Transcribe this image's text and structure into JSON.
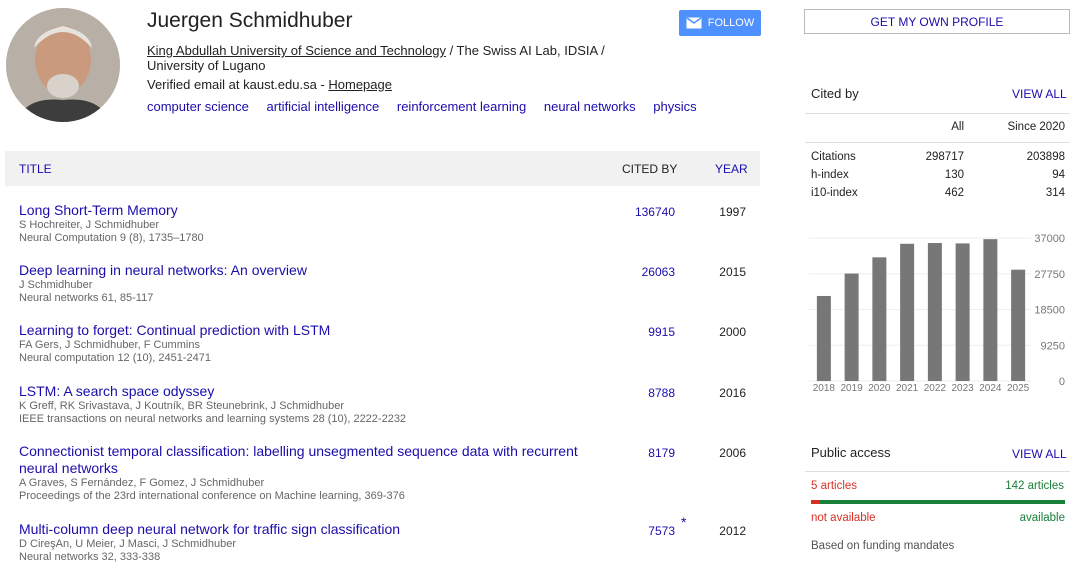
{
  "profile": {
    "name": "Juergen Schmidhuber",
    "affiliation_link": "King Abdullah University of Science and Technology",
    "affiliation_rest": " / The Swiss AI Lab, IDSIA / University of Lugano",
    "email_text": "Verified email at kaust.edu.sa - ",
    "homepage_link": "Homepage",
    "interests": [
      "computer science",
      "artificial intelligence",
      "reinforcement learning",
      "neural networks",
      "physics"
    ],
    "follow_label": "FOLLOW"
  },
  "table": {
    "col_title": "TITLE",
    "col_cited": "CITED BY",
    "col_year": "YEAR",
    "rows": [
      {
        "title": "Long Short-Term Memory",
        "authors": "S Hochreiter, J Schmidhuber",
        "venue": "Neural Computation 9 (8), 1735–1780",
        "cited": "136740",
        "year": "1997"
      },
      {
        "title": "Deep learning in neural networks: An overview",
        "authors": "J Schmidhuber",
        "venue": "Neural networks 61, 85-117",
        "cited": "26063",
        "year": "2015"
      },
      {
        "title": "Learning to forget: Continual prediction with LSTM",
        "authors": "FA Gers, J Schmidhuber, F Cummins",
        "venue": "Neural computation 12 (10), 2451-2471",
        "cited": "9915",
        "year": "2000"
      },
      {
        "title": "LSTM: A search space odyssey",
        "authors": "K Greff, RK Srivastava, J Koutník, BR Steunebrink, J Schmidhuber",
        "venue": "IEEE transactions on neural networks and learning systems 28 (10), 2222-2232",
        "cited": "8788",
        "year": "2016"
      },
      {
        "title": "Connectionist temporal classification: labelling unsegmented sequence data with recurrent neural networks",
        "authors": "A Graves, S Fernández, F Gomez, J Schmidhuber",
        "venue": "Proceedings of the 23rd international conference on Machine learning, 369-376",
        "cited": "8179",
        "year": "2006"
      },
      {
        "title": "Multi-column deep neural network for traffic sign classification",
        "authors": "D CireşAn, U Meier, J Masci, J Schmidhuber",
        "venue": "Neural networks 32, 333-338",
        "cited": "7573",
        "year": "2012",
        "star": "*"
      }
    ]
  },
  "sidebar": {
    "own_profile_label": "GET MY OWN PROFILE",
    "cited_by": {
      "heading": "Cited by",
      "view_all": "VIEW ALL",
      "col_all": "All",
      "col_since": "Since 2020",
      "rows": [
        {
          "label": "Citations",
          "all": "298717",
          "since": "203898"
        },
        {
          "label": "h-index",
          "all": "130",
          "since": "94"
        },
        {
          "label": "i10-index",
          "all": "462",
          "since": "314"
        }
      ]
    },
    "public_access": {
      "heading": "Public access",
      "view_all": "VIEW ALL",
      "unavailable_count": "5 articles",
      "available_count": "142 articles",
      "unavailable_label": "not available",
      "available_label": "available",
      "note": "Based on funding mandates",
      "unavailable_fraction": 0.034
    }
  },
  "chart_data": {
    "type": "bar",
    "categories": [
      "2018",
      "2019",
      "2020",
      "2021",
      "2022",
      "2023",
      "2024",
      "2025"
    ],
    "values": [
      22000,
      27800,
      32000,
      35500,
      35700,
      35600,
      36700,
      28800
    ],
    "yticks": [
      "37000",
      "27750",
      "18500",
      "9250",
      "0"
    ],
    "ylim": [
      0,
      37000
    ],
    "grid": true,
    "bar_color": "#777777"
  }
}
